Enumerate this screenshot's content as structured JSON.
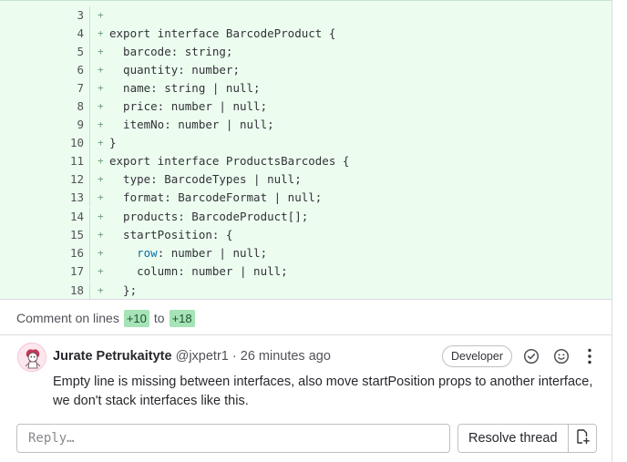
{
  "diff": {
    "lines": [
      {
        "num": "3",
        "sign": "+",
        "code": ""
      },
      {
        "num": "4",
        "sign": "+",
        "code": "export interface BarcodeProduct {"
      },
      {
        "num": "5",
        "sign": "+",
        "code": "  barcode: string;"
      },
      {
        "num": "6",
        "sign": "+",
        "code": "  quantity: number;"
      },
      {
        "num": "7",
        "sign": "+",
        "code": "  name: string | null;"
      },
      {
        "num": "8",
        "sign": "+",
        "code": "  price: number | null;"
      },
      {
        "num": "9",
        "sign": "+",
        "code": "  itemNo: number | null;"
      },
      {
        "num": "10",
        "sign": "+",
        "code": "}"
      },
      {
        "num": "11",
        "sign": "+",
        "code": "export interface ProductsBarcodes {"
      },
      {
        "num": "12",
        "sign": "+",
        "code": "  type: BarcodeTypes | null;"
      },
      {
        "num": "13",
        "sign": "+",
        "code": "  format: BarcodeFormat | null;"
      },
      {
        "num": "14",
        "sign": "+",
        "code": "  products: BarcodeProduct[];"
      },
      {
        "num": "15",
        "sign": "+",
        "code": "  startPosition: {"
      },
      {
        "num": "16",
        "sign": "+",
        "code": "    row: number | null;"
      },
      {
        "num": "17",
        "sign": "+",
        "code": "    column: number | null;"
      },
      {
        "num": "18",
        "sign": "+",
        "code": "  };"
      }
    ]
  },
  "comment_on": {
    "prefix": "Comment on lines",
    "from": "+10",
    "joiner": "to",
    "to": "+18"
  },
  "note": {
    "author": "Jurate Petrukaityte",
    "username": "@jxpetr1",
    "separator": "·",
    "time": "26 minutes ago",
    "role": "Developer",
    "body": "Empty line is missing between interfaces, also move startPosition props to another interface, we don't stack interfaces like this."
  },
  "reply": {
    "placeholder": "Reply…",
    "resolve_label": "Resolve thread"
  },
  "icons": {
    "resolve": "check-circle-icon",
    "emoji": "smiley-icon",
    "more": "kebab-menu-icon",
    "issue": "create-issue-icon"
  },
  "colors": {
    "diff_bg": "#ecfdf0",
    "badge_bg": "#a6e3b6",
    "text": "#28272d"
  }
}
